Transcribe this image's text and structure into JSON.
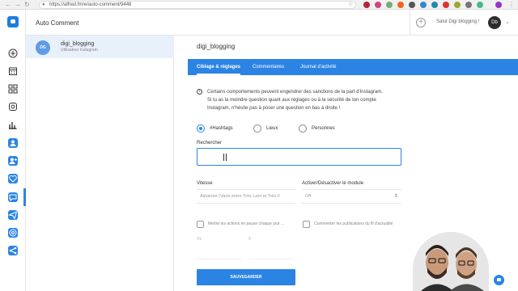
{
  "browser": {
    "url": "https://alfred.fm/e/auto-comment/9448",
    "back_icon": "arrow-left-icon",
    "forward_icon": "arrow-right-icon",
    "reload_icon": "reload-icon"
  },
  "app": {
    "title": "Auto Comment",
    "greeting": "Salut Digi blogging !",
    "user_initials": "Db"
  },
  "account": {
    "initials": "DG",
    "name": "digi_blogging",
    "subtitle": "Utilisateur Instagram"
  },
  "main": {
    "title": "digi_blogging",
    "tabs": [
      {
        "label": "Ciblage & réglages",
        "active": true
      },
      {
        "label": "Commentaires",
        "active": false
      },
      {
        "label": "Journal d'activité",
        "active": false
      }
    ],
    "info_lines": [
      "Certains comportements peuvent engendrer des sanctions de la part d'Instagram.",
      "Si tu as la moindre question quant aux réglages ou à la sécurité de ton compte",
      "Instagram, n'hésite pas à poser une question en bas à droite !"
    ],
    "radios": [
      {
        "label": "#Hashtags",
        "selected": true
      },
      {
        "label": "Lieux",
        "selected": false
      },
      {
        "label": "Personnes",
        "selected": false
      }
    ],
    "search_label": "Rechercher",
    "search_value": "",
    "speed_label": "Vitesse",
    "speed_value": "Aléatoire (Varie entre Très Lent et Très F",
    "module_label": "Activer/Désactiver le module",
    "module_value": "Off",
    "pause_checkbox_label": "Mettre les actions en pause chaque jour ...",
    "feed_checkbox_label": "Commenter les publications du fil d'actualité",
    "from_label": "De",
    "to_label": "À",
    "save_label": "SAUVEGARDER"
  },
  "colors": {
    "accent": "#2b84e4",
    "sidebar_active": "#2b84e4"
  }
}
